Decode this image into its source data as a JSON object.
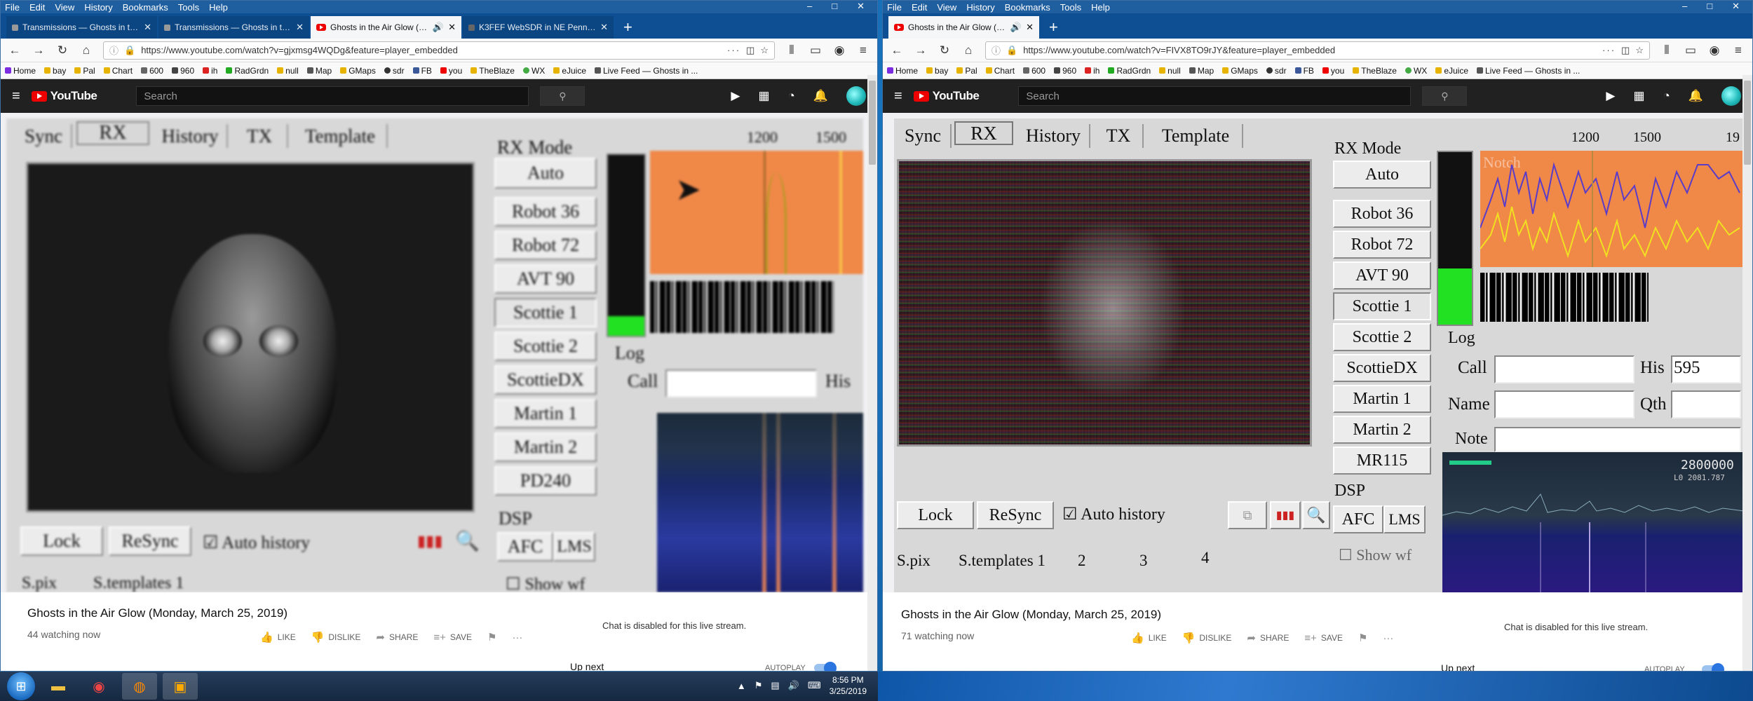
{
  "menu_items": [
    "File",
    "Edit",
    "View",
    "History",
    "Bookmarks",
    "Tools",
    "Help"
  ],
  "window_controls": {
    "minimize": "–",
    "maximize": "□",
    "close": "✕"
  },
  "left": {
    "tabs": [
      {
        "label": "Transmissions — Ghosts in the Air"
      },
      {
        "label": "Transmissions — Ghosts in the Air"
      },
      {
        "label": "Ghosts in the Air Glow (Monday, March 25, 2019)"
      },
      {
        "label": "K3FEF WebSDR in NE Pennsylvania"
      }
    ],
    "url": "https://www.youtube.com/watch?v=gjxmsg4WQDg&feature=player_embedded",
    "watching": "44 watching now"
  },
  "right": {
    "tabs": [
      {
        "label": "Ghosts in the Air Glow (Monday, March 25, 2019)"
      }
    ],
    "url": "https://www.youtube.com/watch?v=FIVX8TO9rJY&feature=player_embedded",
    "watching": "71 watching now"
  },
  "bookmarks": [
    "Home",
    "bay",
    "Pal",
    "Chart",
    "600",
    "960",
    "ih",
    "RadGrdn",
    "null",
    "Map",
    "GMaps",
    "sdr",
    "FB",
    "you",
    "TheBlaze",
    "WX",
    "eJuice",
    "Live Feed — Ghosts in ..."
  ],
  "youtube": {
    "brand": "YouTube",
    "search_placeholder": "Search",
    "video_title": "Ghosts in the Air Glow (Monday, March 25, 2019)",
    "actions": {
      "like": "LIKE",
      "dislike": "DISLIKE",
      "share": "SHARE",
      "save": "SAVE",
      "more": "···"
    },
    "chat_disabled": "Chat is disabled for this live stream.",
    "up_next": "Up next",
    "autoplay": "AUTOPLAY"
  },
  "mmsstv": {
    "tabs": [
      "Sync",
      "RX",
      "History",
      "TX",
      "Template"
    ],
    "rx_mode_label": "RX Mode",
    "modes": [
      "Auto",
      "Robot 36",
      "Robot 72",
      "AVT 90",
      "Scottie 1",
      "Scottie 2",
      "ScottieDX",
      "Martin 1",
      "Martin 2",
      "PD240"
    ],
    "modes_right": [
      "Auto",
      "Robot 36",
      "Robot 72",
      "AVT 90",
      "Scottie 1",
      "Scottie 2",
      "ScottieDX",
      "Martin 1",
      "Martin 2",
      "MR115"
    ],
    "freq_1200": "1200",
    "freq_1500": "1500",
    "freq_19": "19",
    "notch": "Notch",
    "log_label": "Log",
    "call": "Call",
    "his": "His",
    "his_value": "595",
    "name": "Name",
    "qth": "Qth",
    "note": "Note",
    "dsp": "DSP",
    "afc": "AFC",
    "lms": "LMS",
    "lock": "Lock",
    "resync": "ReSync",
    "auto_history": "Auto history",
    "spix": "S.pix",
    "stemplates": "S.templates 1",
    "t2": "2",
    "t3": "3",
    "t4": "4",
    "show_wf": "Show wf",
    "sdr_freq": "2800000",
    "sdr_sub": "L0    2081.787"
  },
  "taskbar": {
    "time": "8:56 PM",
    "date": "3/25/2019"
  }
}
